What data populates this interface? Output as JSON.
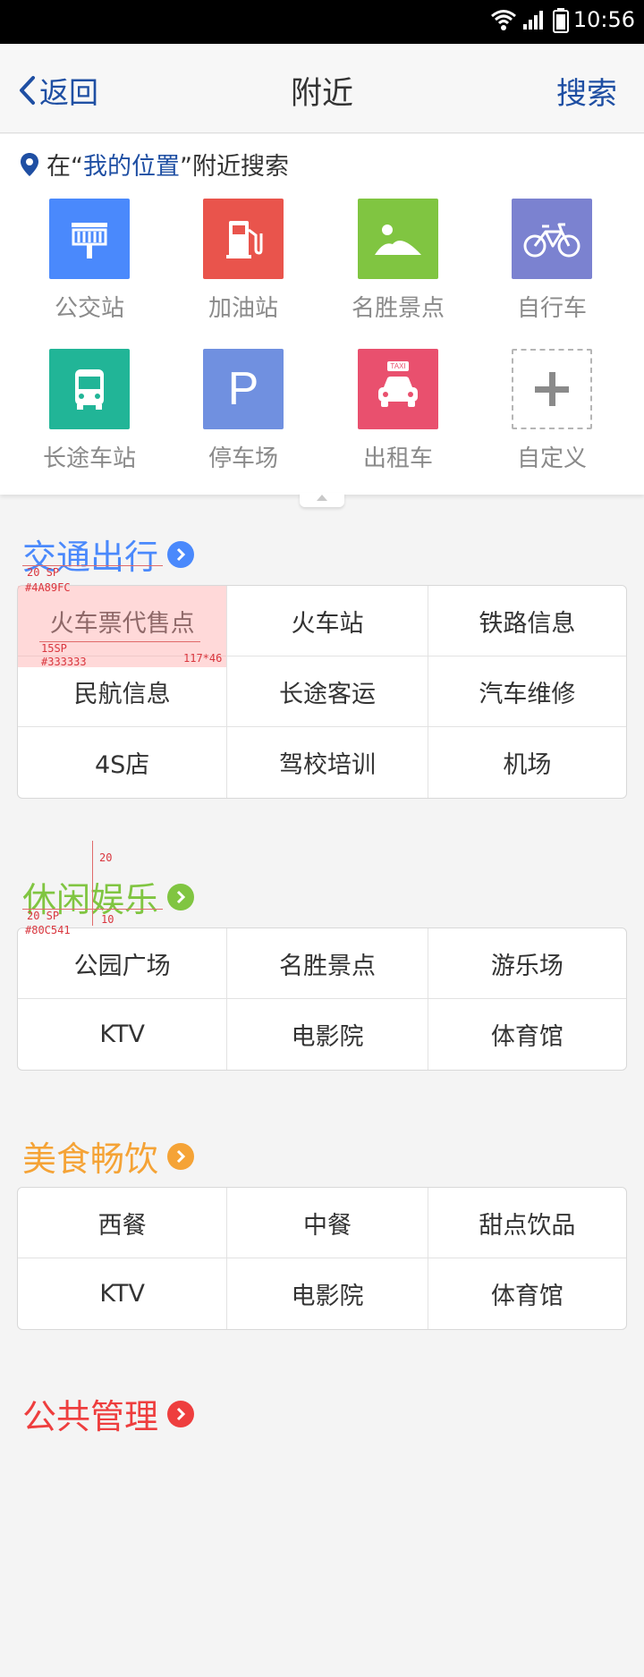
{
  "status_bar": {
    "time": "10:56"
  },
  "nav": {
    "back_label": "返回",
    "title": "附近",
    "search_label": "搜索"
  },
  "nearby": {
    "prefix": "在“",
    "location": "我的位置",
    "suffix": "”附近搜索",
    "items": [
      {
        "label": "公交站",
        "color": "#4a89fc",
        "icon": "bus-stop-icon"
      },
      {
        "label": "加油站",
        "color": "#e9544c",
        "icon": "gas-station-icon"
      },
      {
        "label": "名胜景点",
        "color": "#80c541",
        "icon": "landscape-icon"
      },
      {
        "label": "自行车",
        "color": "#7b82d0",
        "icon": "bicycle-icon"
      },
      {
        "label": "长途车站",
        "color": "#21b597",
        "icon": "coach-icon"
      },
      {
        "label": "停车场",
        "color": "#7090e0",
        "icon": "parking-icon",
        "glyph": "P"
      },
      {
        "label": "出租车",
        "color": "#e9506e",
        "icon": "taxi-icon",
        "badge": "TAXI"
      },
      {
        "label": "自定义",
        "color": "#8a8a8a",
        "icon": "plus-icon"
      }
    ]
  },
  "sections": [
    {
      "title": "交通出行",
      "color": "#4A89FC",
      "rows": [
        [
          "火车票代售点",
          "火车站",
          "铁路信息"
        ],
        [
          "民航信息",
          "长途客运",
          "汽车维修"
        ],
        [
          "4S店",
          "驾校培训",
          "机场"
        ]
      ]
    },
    {
      "title": "休闲娱乐",
      "color": "#80C541",
      "rows": [
        [
          "公园广场",
          "名胜景点",
          "游乐场"
        ],
        [
          "KTV",
          "电影院",
          "体育馆"
        ]
      ]
    },
    {
      "title": "美食畅饮",
      "color": "#f5a336",
      "rows": [
        [
          "西餐",
          "中餐",
          "甜点饮品"
        ],
        [
          "KTV",
          "电影院",
          "体育馆"
        ]
      ]
    },
    {
      "title": "公共管理",
      "color": "#ee3e3e",
      "rows": []
    }
  ],
  "annotations": {
    "title1_size": "20 SP",
    "title1_color": "#4A89FC",
    "cell_size": "15SP",
    "cell_color": "#333333",
    "cell_dim": "117*46",
    "gap_top": "20",
    "title2_size": "20 SP",
    "title2_color": "#80C541",
    "gap_bottom": "10"
  },
  "colors": {
    "accent_blue": "#1f4fa3"
  }
}
